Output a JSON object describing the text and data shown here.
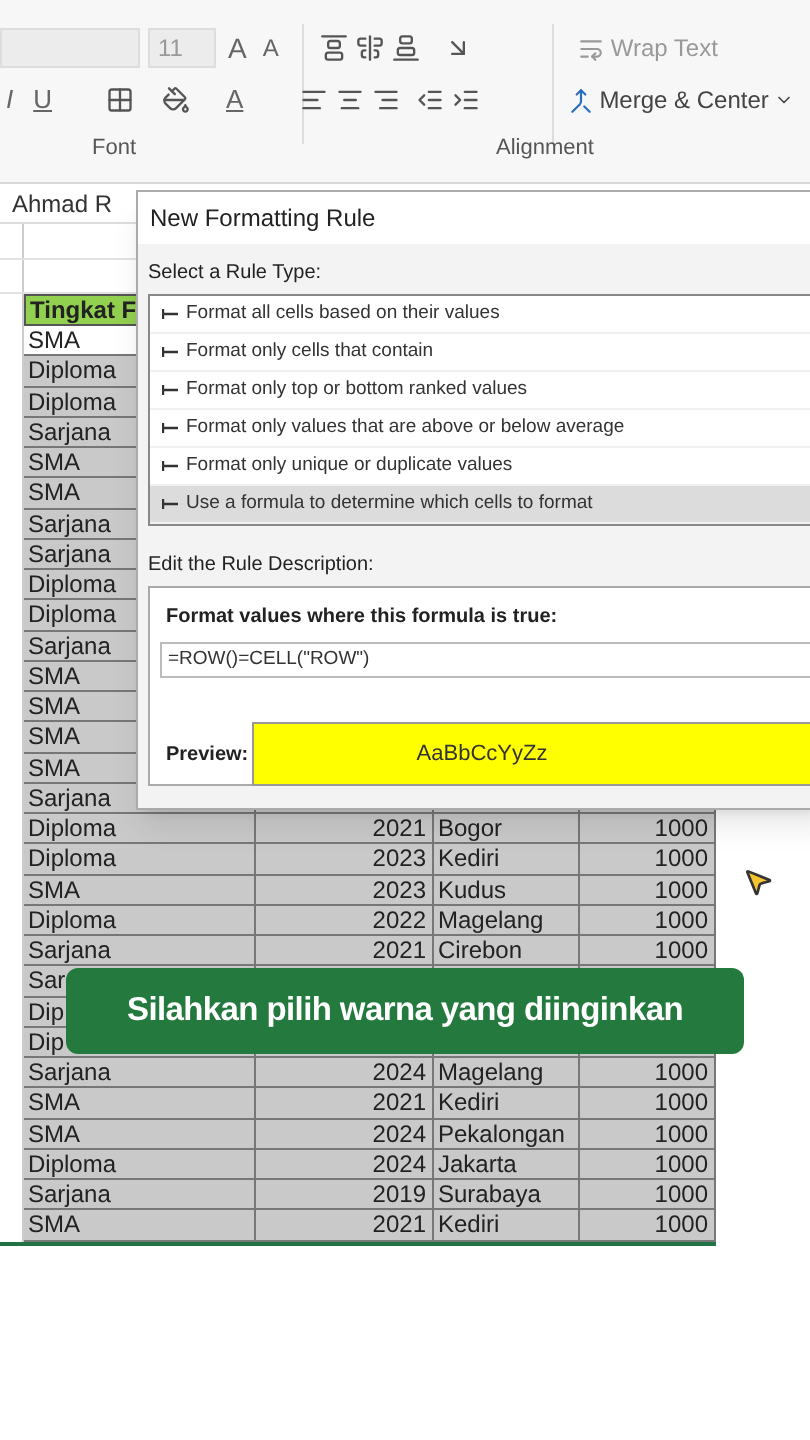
{
  "ribbon": {
    "font_size": "11",
    "grow_font": "A",
    "shrink_font": "A",
    "wrap_text": "Wrap Text",
    "italic": "I",
    "underline": "U",
    "font_color": "A",
    "merge_center": "Merge & Center",
    "groups": [
      "Font",
      "Alignment"
    ]
  },
  "name_box": "Ahmad R",
  "sheet": {
    "header": "Tingkat F",
    "rows": [
      {
        "level": "SMA",
        "active": true
      },
      {
        "level": "Diploma",
        "active": false
      },
      {
        "level": "Diploma",
        "active": false
      },
      {
        "level": "Sarjana",
        "active": false
      },
      {
        "level": "SMA",
        "active": false
      },
      {
        "level": "SMA",
        "active": false
      },
      {
        "level": "Sarjana",
        "active": false
      },
      {
        "level": "Sarjana",
        "active": false
      },
      {
        "level": "Diploma",
        "active": false
      },
      {
        "level": "Diploma",
        "active": false
      },
      {
        "level": "Sarjana",
        "active": false
      },
      {
        "level": "SMA",
        "active": false
      },
      {
        "level": "SMA",
        "active": false
      },
      {
        "level": "SMA",
        "active": false
      },
      {
        "level": "SMA",
        "active": false
      },
      {
        "level": "Sarjana",
        "active": false
      },
      {
        "level": "Diploma",
        "year": "2021",
        "city": "Bogor",
        "amount": "1000",
        "active": false
      },
      {
        "level": "Diploma",
        "year": "2023",
        "city": "Kediri",
        "amount": "1000",
        "active": false
      },
      {
        "level": "SMA",
        "year": "2023",
        "city": "Kudus",
        "amount": "1000",
        "active": false
      },
      {
        "level": "Diploma",
        "year": "2022",
        "city": "Magelang",
        "amount": "1000",
        "active": false
      },
      {
        "level": "Sarjana",
        "year": "2021",
        "city": "Cirebon",
        "amount": "1000",
        "active": false
      },
      {
        "level": "Sar",
        "active": false
      },
      {
        "level": "Dip",
        "active": false
      },
      {
        "level": "Dip",
        "active": false
      },
      {
        "level": "Sarjana",
        "year": "2024",
        "city": "Magelang",
        "amount": "1000",
        "active": false
      },
      {
        "level": "SMA",
        "year": "2021",
        "city": "Kediri",
        "amount": "1000",
        "active": false
      },
      {
        "level": "SMA",
        "year": "2024",
        "city": "Pekalongan",
        "amount": "1000",
        "active": false
      },
      {
        "level": "Diploma",
        "year": "2024",
        "city": "Jakarta",
        "amount": "1000",
        "active": false
      },
      {
        "level": "Sarjana",
        "year": "2019",
        "city": "Surabaya",
        "amount": "1000",
        "active": false
      },
      {
        "level": "SMA",
        "year": "2021",
        "city": "Kediri",
        "amount": "1000",
        "active": false
      }
    ]
  },
  "dialog": {
    "title": "New Formatting Rule",
    "rule_type_label": "Select a Rule Type:",
    "rule_types": [
      {
        "label": "Format all cells based on their values",
        "selected": false
      },
      {
        "label": "Format only cells that contain",
        "selected": false
      },
      {
        "label": "Format only top or bottom ranked values",
        "selected": false
      },
      {
        "label": "Format only values that are above or below average",
        "selected": false
      },
      {
        "label": "Format only unique or duplicate values",
        "selected": false
      },
      {
        "label": "Use a formula to determine which cells to format",
        "selected": true
      }
    ],
    "description_label": "Edit the Rule Description:",
    "formula_label": "Format values where this formula is true:",
    "formula": "=ROW()=CELL(\"ROW\")",
    "preview_label": "Preview:",
    "preview_sample": "AaBbCcYyZz"
  },
  "banner": "Silahkan pilih warna yang diinginkan"
}
